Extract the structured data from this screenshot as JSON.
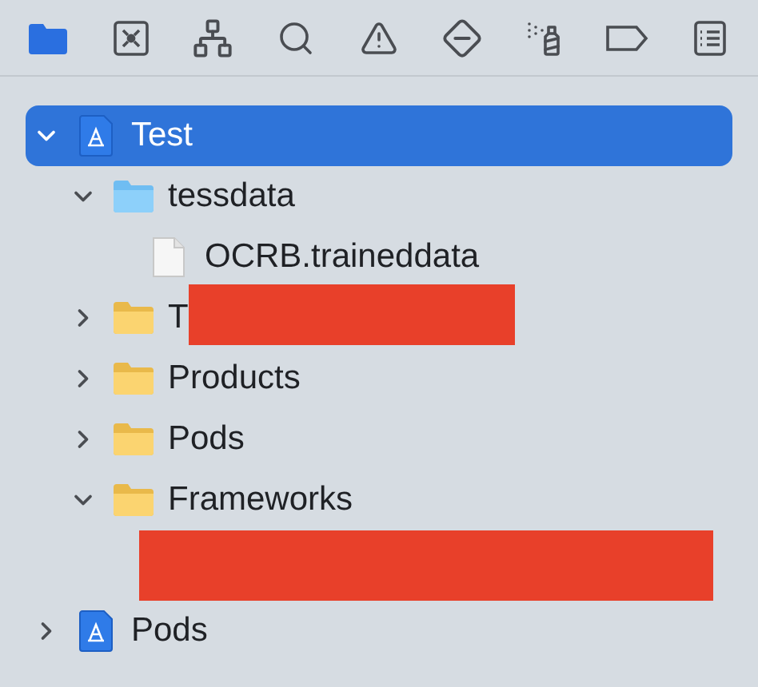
{
  "navigator_tabs": [
    {
      "kind": "project",
      "selected": true
    },
    {
      "kind": "source_control",
      "selected": false
    },
    {
      "kind": "symbols",
      "selected": false
    },
    {
      "kind": "find",
      "selected": false
    },
    {
      "kind": "issues",
      "selected": false
    },
    {
      "kind": "tests",
      "selected": false
    },
    {
      "kind": "debug",
      "selected": false
    },
    {
      "kind": "breakpoints",
      "selected": false
    },
    {
      "kind": "reports",
      "selected": false
    }
  ],
  "tree": [
    {
      "kind": "project",
      "label": "Test",
      "selected": true,
      "expanded": true,
      "children": [
        {
          "kind": "blue_folder",
          "label": "tessdata",
          "selected": false,
          "expanded": true,
          "children": [
            {
              "kind": "file",
              "label": "OCRB.traineddata",
              "selected": false
            }
          ]
        },
        {
          "kind": "folder",
          "label": "T",
          "selected": false,
          "expanded": false,
          "redacted": true
        },
        {
          "kind": "folder",
          "label": "Products",
          "selected": false,
          "expanded": false
        },
        {
          "kind": "folder",
          "label": "Pods",
          "selected": false,
          "expanded": false
        },
        {
          "kind": "folder",
          "label": "Frameworks",
          "selected": false,
          "expanded": true,
          "children": [
            {
              "kind": "redacted"
            }
          ]
        }
      ]
    },
    {
      "kind": "project",
      "label": "Pods",
      "selected": false,
      "expanded": false
    }
  ]
}
